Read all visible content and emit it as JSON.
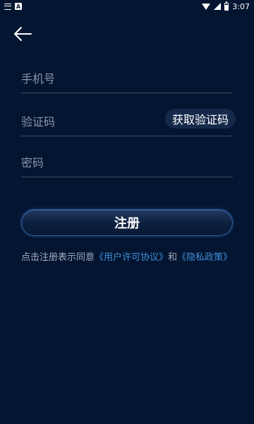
{
  "status_bar": {
    "time": "3:07",
    "a_label": "A"
  },
  "form": {
    "phone_placeholder": "手机号",
    "code_placeholder": "验证码",
    "get_code_label": "获取验证码",
    "password_placeholder": "密码",
    "register_label": "注册"
  },
  "agreement": {
    "prefix": "点击注册表示同意",
    "user_agreement": "《用户许可协议》",
    "and": "和",
    "privacy_policy": "《隐私政策》"
  },
  "colors": {
    "background": "#041531",
    "link": "#3f8ed8",
    "button_border": "#2d5fa5"
  }
}
